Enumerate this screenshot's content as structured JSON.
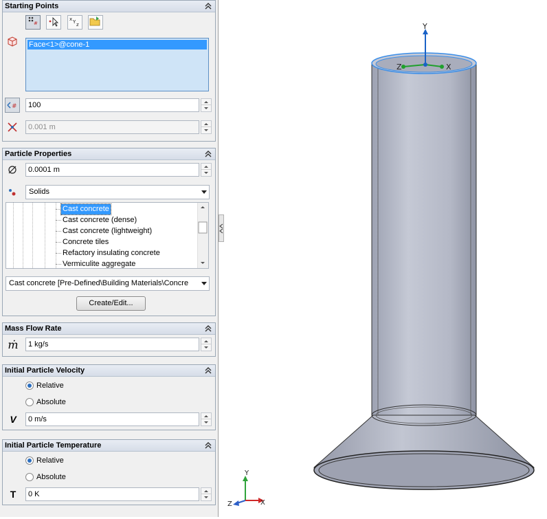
{
  "starting_points": {
    "title": "Starting Points",
    "toolbar": [
      "starting-points-tool",
      "pick-point-tool",
      "xyz-coordinates-tool",
      "open-folder-tool"
    ],
    "xyz_label": "xyz",
    "face_item": "Face<1>@cone-1",
    "number_of_points": "100",
    "offset": "0.001 m"
  },
  "particle_properties": {
    "title": "Particle Properties",
    "diameter": "0.0001 m",
    "material_type": "Solids",
    "materials": [
      "Cast concrete",
      "Cast concrete (dense)",
      "Cast concrete (lightweight)",
      "Concrete tiles",
      "Refactory insulating concrete",
      "Vermiculite aggregate"
    ],
    "selected_material": "Cast concrete [Pre-Defined\\Building Materials\\Concre",
    "create_edit_label": "Create/Edit..."
  },
  "mass_flow_rate": {
    "title": "Mass Flow Rate",
    "symbol": "ṁ",
    "value": "1 kg/s"
  },
  "initial_velocity": {
    "title": "Initial Particle Velocity",
    "options": [
      "Relative",
      "Absolute"
    ],
    "selected": "Relative",
    "symbol": "V",
    "value": "0 m/s"
  },
  "initial_temperature": {
    "title": "Initial Particle Temperature",
    "options": [
      "Relative",
      "Absolute"
    ],
    "selected": "Relative",
    "symbol": "T",
    "value": "0 K"
  },
  "viewport": {
    "axes_labels": {
      "x": "X",
      "y": "Y",
      "z": "Z"
    },
    "model_color": "#b4b9c8",
    "highlight_color": "#3b8ee8"
  }
}
